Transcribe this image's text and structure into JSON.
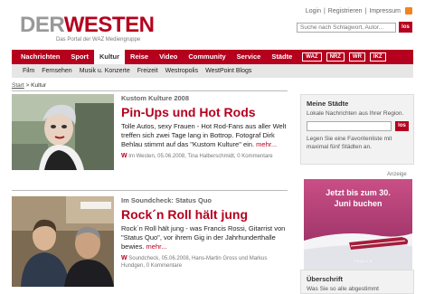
{
  "header": {
    "logo_der": "DER",
    "logo_westen": "WESTEN",
    "logo_sub": "Das Portal der WAZ Mediengruppe",
    "top_links": [
      "Login",
      "Registrieren",
      "Impressum"
    ],
    "separator": "|",
    "search_placeholder": "Suche nach Schlagwort, Autor...",
    "search_button": "los"
  },
  "nav": {
    "items": [
      "Nachrichten",
      "Sport",
      "Kultur",
      "Reise",
      "Video",
      "Community",
      "Service",
      "Städte"
    ],
    "active": "Kultur",
    "partner_logos": [
      "WAZ",
      "NRZ",
      "WR",
      "IKZ"
    ]
  },
  "subnav": {
    "items": [
      "Film",
      "Fernsehen",
      "Musik u. Konzerte",
      "Freizeit",
      "Westropolis",
      "WestPoint Blogs"
    ]
  },
  "breadcrumb": {
    "home": "Start",
    "sep": ">",
    "current": "Kultur"
  },
  "articles": [
    {
      "kicker": "Kustom Kulture 2008",
      "headline": "Pin-Ups und Hot Rods",
      "teaser": "Tolle Autos, sexy Frauen - Hot Rod-Fans aus aller Welt treffen sich zwei Tage lang in Bottrop. Fotograf Dirk Behlau stimmt auf das \"Kustom Kulture\" ein.",
      "more": "mehr...",
      "meta_logo": "W",
      "meta": "Im Westen, 05.06.2008, Tina Halberschmidt, 0 Kommentare"
    },
    {
      "kicker": "Im Soundcheck: Status Quo",
      "headline": "Rock´n Roll hält jung",
      "teaser": "Rock´n Roll hält jung - was Francis Rossi, Gitarrist von \"Status Quo\", vor ihrem Gig in der Jahrhunderthalle bewies.",
      "more": "mehr...",
      "meta_logo": "W",
      "meta": "Soundcheck, 05.06.2008, Hans-Martin Gross und Markus Hundgen, 0 Kommentare"
    }
  ],
  "sidebar": {
    "staedte": {
      "title": "Meine Städte",
      "text": "Lokale Nachrichten aus Ihrer Region.",
      "button": "los",
      "note": "Legen Sie eine Favoritenliste mit maximal fünf Städten an."
    },
    "ad": {
      "label": "Anzeige",
      "line1": "Jetzt bis zum 30.",
      "line2": "Juni buchen",
      "brand": "THALYS"
    },
    "uebersicht": {
      "title": "Überschrift",
      "text": "Was Sie so alle abgestimmt"
    }
  },
  "colors": {
    "brand_red": "#b5001e",
    "subnav_bg": "#e6e6e6",
    "sidebar_bg": "#f2f2f2"
  }
}
